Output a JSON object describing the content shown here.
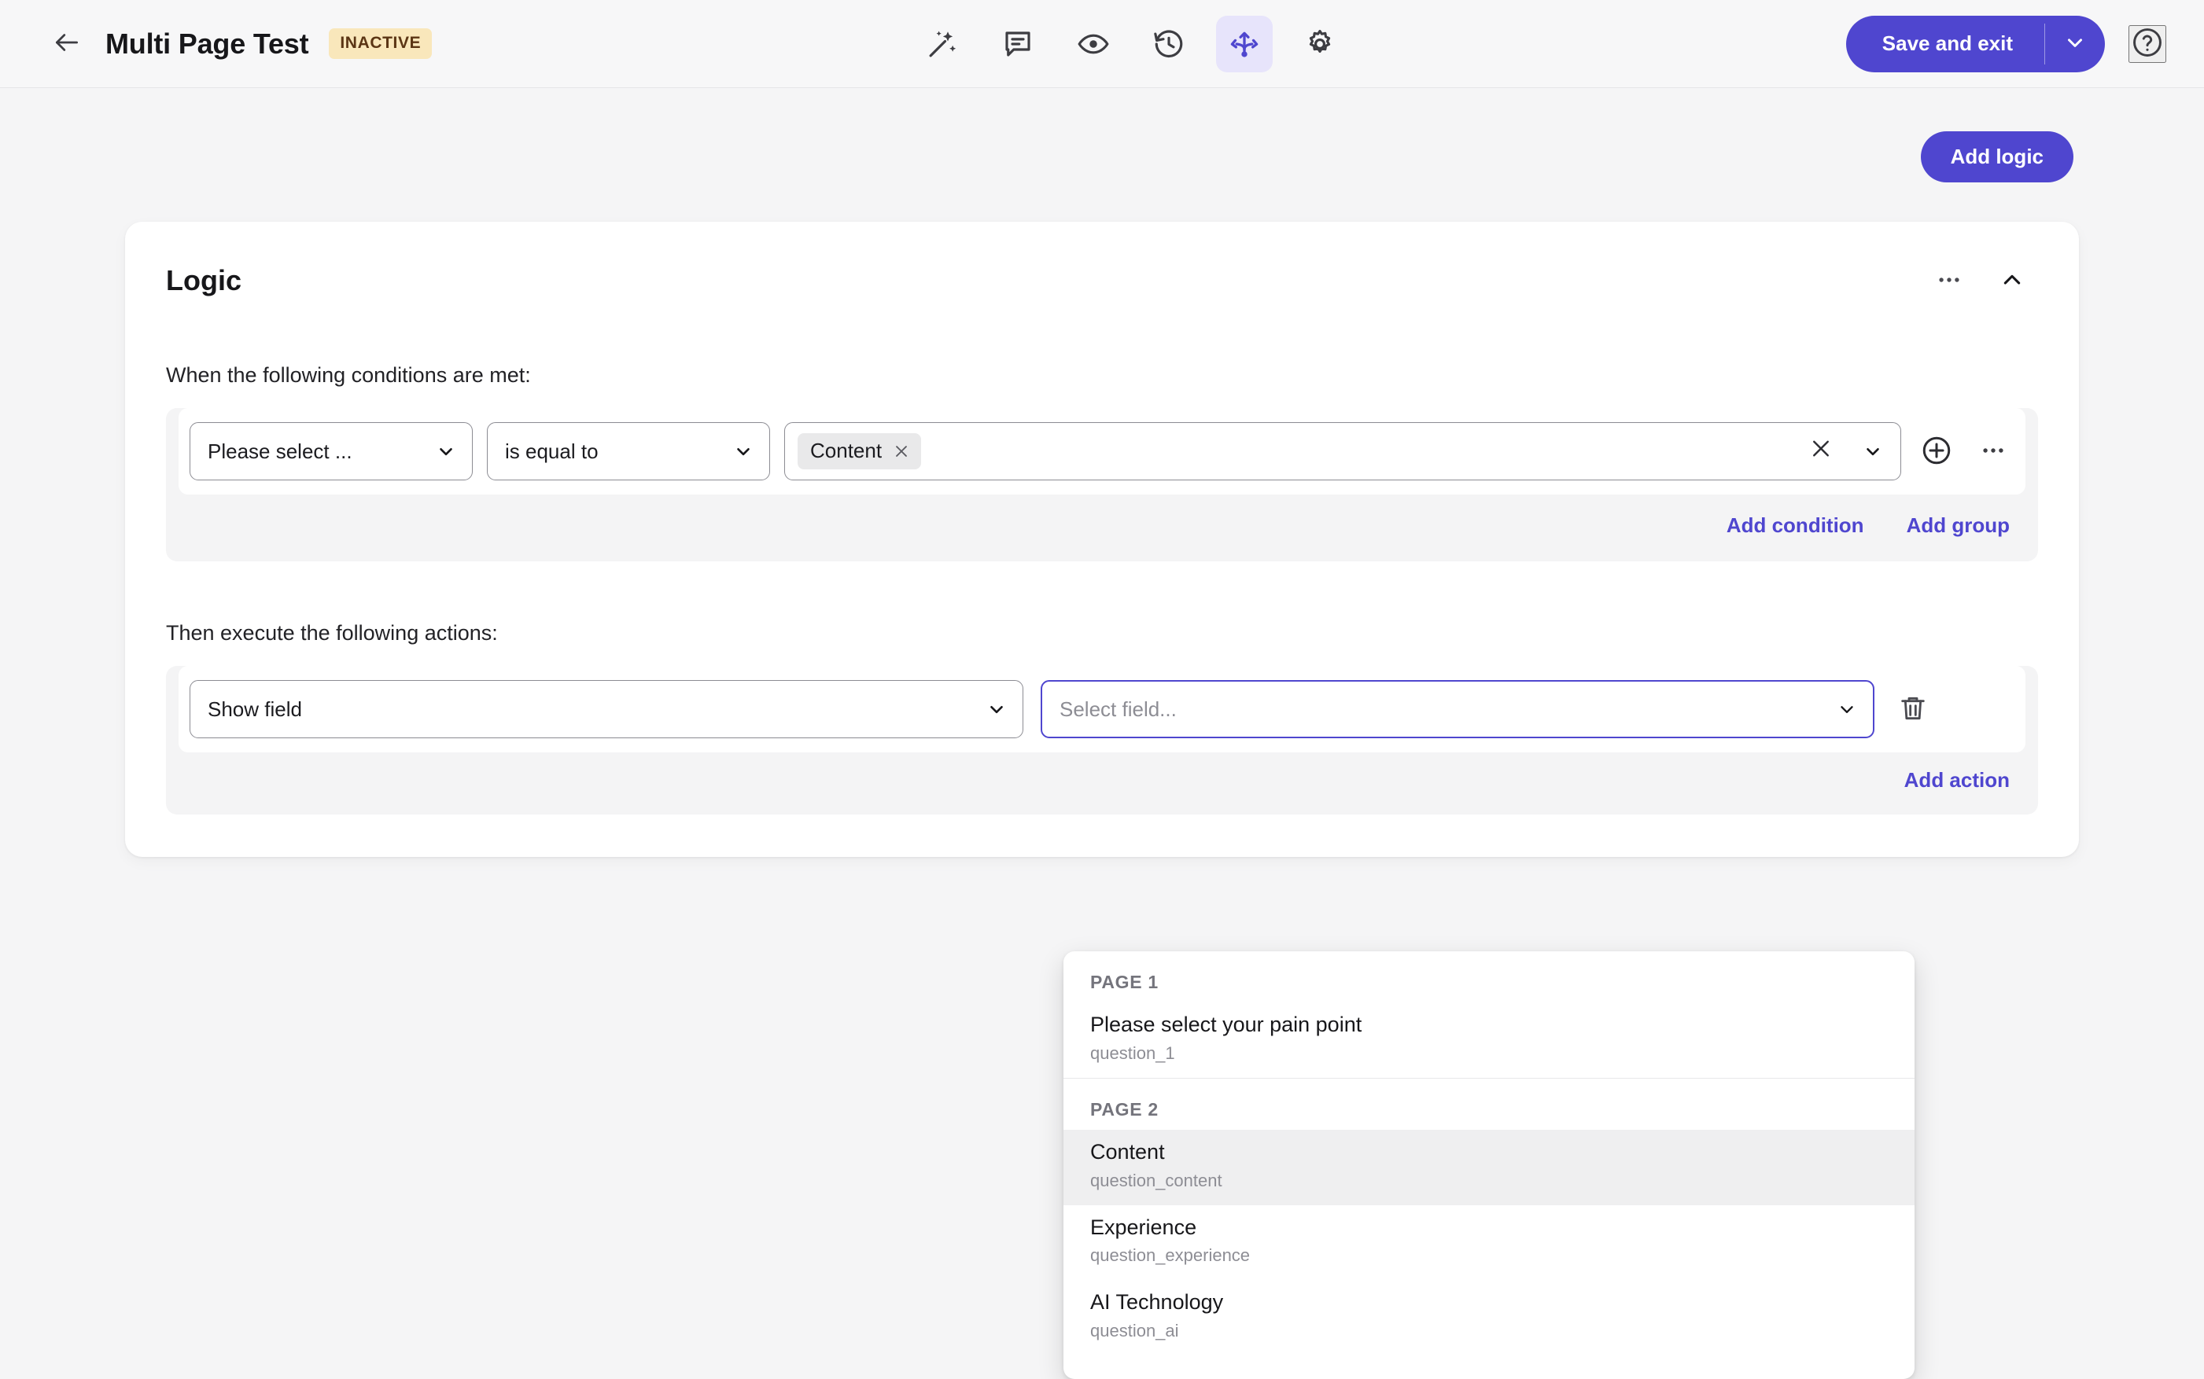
{
  "topbar": {
    "back_icon": "arrow-left-icon",
    "title": "Multi Page Test",
    "status": "INACTIVE",
    "tools": [
      {
        "name": "magic-wand-icon",
        "label": "Design",
        "active": false
      },
      {
        "name": "comment-icon",
        "label": "Comments",
        "active": false
      },
      {
        "name": "eye-icon",
        "label": "Preview",
        "active": false
      },
      {
        "name": "history-icon",
        "label": "History",
        "active": false
      },
      {
        "name": "logic-branch-icon",
        "label": "Logic",
        "active": true
      },
      {
        "name": "gear-icon",
        "label": "Settings",
        "active": false
      }
    ],
    "save_label": "Save and exit",
    "save_caret_icon": "chevron-down-icon",
    "help_icon": "question-circle-icon"
  },
  "toolbar": {
    "add_logic_label": "Add logic"
  },
  "card": {
    "title": "Logic",
    "more_icon": "ellipsis-icon",
    "collapse_icon": "chevron-up-icon",
    "conditions_label": "When the following conditions are met:",
    "actions_label": "Then execute the following actions:"
  },
  "condition": {
    "field_value": "Please select ...",
    "operator_value": "is equal to",
    "values": [
      "Content"
    ],
    "chip_remove_icon": "close-icon",
    "clear_icon": "close-icon",
    "caret_icon": "chevron-down-icon",
    "add_icon": "plus-circle-icon",
    "more_icon": "ellipsis-icon",
    "add_condition_label": "Add condition",
    "add_group_label": "Add group"
  },
  "action": {
    "type_value": "Show field",
    "target_placeholder": "Select field...",
    "delete_icon": "trash-icon",
    "caret_icon": "chevron-down-icon",
    "add_action_label": "Add action"
  },
  "dropdown": {
    "groups": [
      {
        "header": "PAGE 1",
        "items": [
          {
            "label": "Please select your pain point",
            "key": "question_1",
            "highlight": false
          }
        ]
      },
      {
        "header": "PAGE 2",
        "items": [
          {
            "label": "Content",
            "key": "question_content",
            "highlight": true
          },
          {
            "label": "Experience",
            "key": "question_experience",
            "highlight": false
          },
          {
            "label": "AI Technology",
            "key": "question_ai",
            "highlight": false
          }
        ]
      }
    ]
  },
  "colors": {
    "accent": "#4F46CF",
    "accent_soft": "#E7E4FB",
    "page_bg": "#F5F5F6",
    "group_bg": "#F4F4F5",
    "badge_bg": "#F9E7BB",
    "badge_fg": "#5B3514",
    "highlight_row": "#EFEFF0"
  }
}
